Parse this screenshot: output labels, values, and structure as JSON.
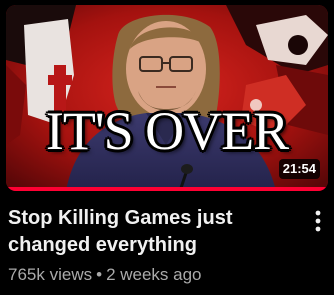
{
  "thumbnail": {
    "overlay_text": "IT'S OVER",
    "duration": "21:54",
    "watch_progress": 1.0
  },
  "video": {
    "title": "Stop Killing Games just changed everything",
    "views": "765k views",
    "separator": "•",
    "age": "2 weeks ago"
  },
  "icons": {
    "menu": "more-vert-icon"
  },
  "colors": {
    "background": "#000000",
    "title_text": "#f1f1f1",
    "meta_text": "#aaaaaa",
    "progress_bar": "#ff0033",
    "thumbnail_red": "#b01416"
  }
}
